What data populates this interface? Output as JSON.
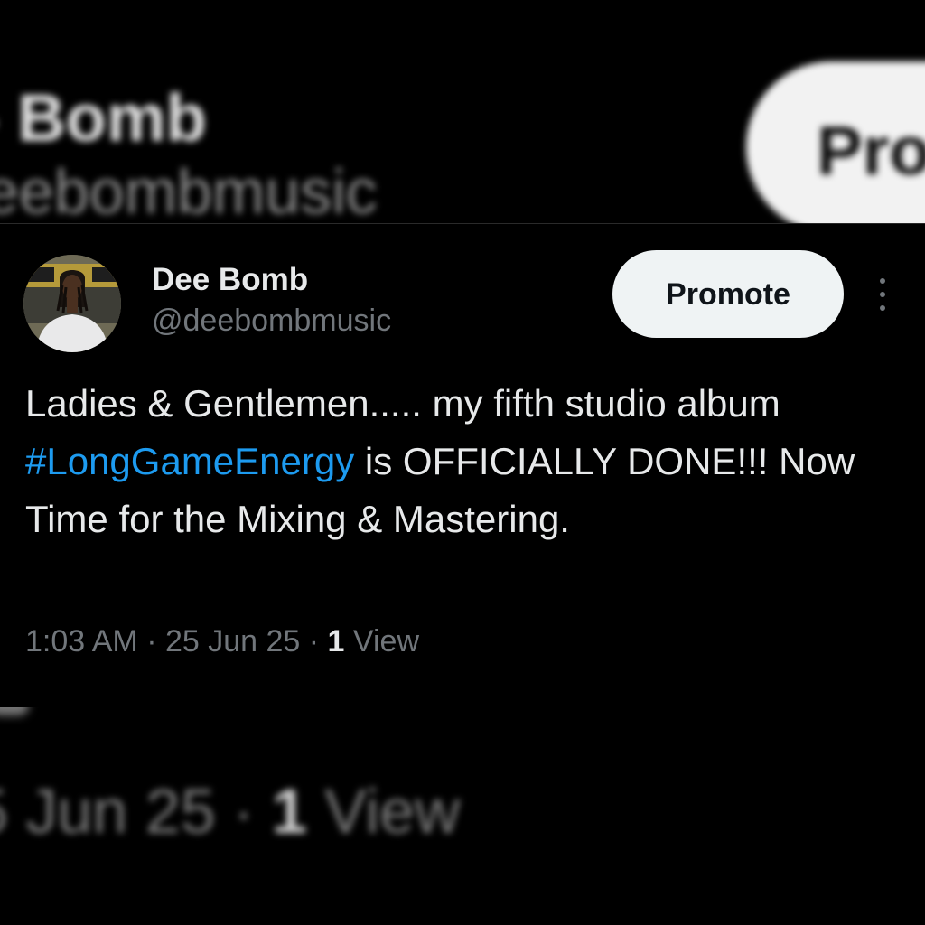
{
  "background": {
    "name_fragment": "Bomb",
    "handle_fragment": "eebombmusic",
    "promote_fragment": "Pro",
    "meta_date_fragment": "5 Jun 25 · ",
    "meta_views_count": "1",
    "meta_views_label": " View"
  },
  "tweet": {
    "author": {
      "display_name": "Dee Bomb",
      "handle": "@deebombmusic",
      "avatar_icon": "profile-photo"
    },
    "promote_label": "Promote",
    "more_icon": "more-vertical-icon",
    "text_before": "Ladies & Gentlemen..... my fifth studio album ",
    "hashtag": "#LongGameEnergy",
    "text_after": " is OFFICIALLY DONE!!! Now Time for the Mixing & Mastering.",
    "time": "1:03 AM",
    "separator": " · ",
    "date": "25 Jun 25",
    "views_count": "1",
    "views_label": " View"
  },
  "colors": {
    "background": "#000000",
    "text_primary": "#e7e9ea",
    "text_secondary": "#71767b",
    "link": "#1d9bf0",
    "button_bg": "#eff3f4",
    "divider": "#2f3336"
  }
}
